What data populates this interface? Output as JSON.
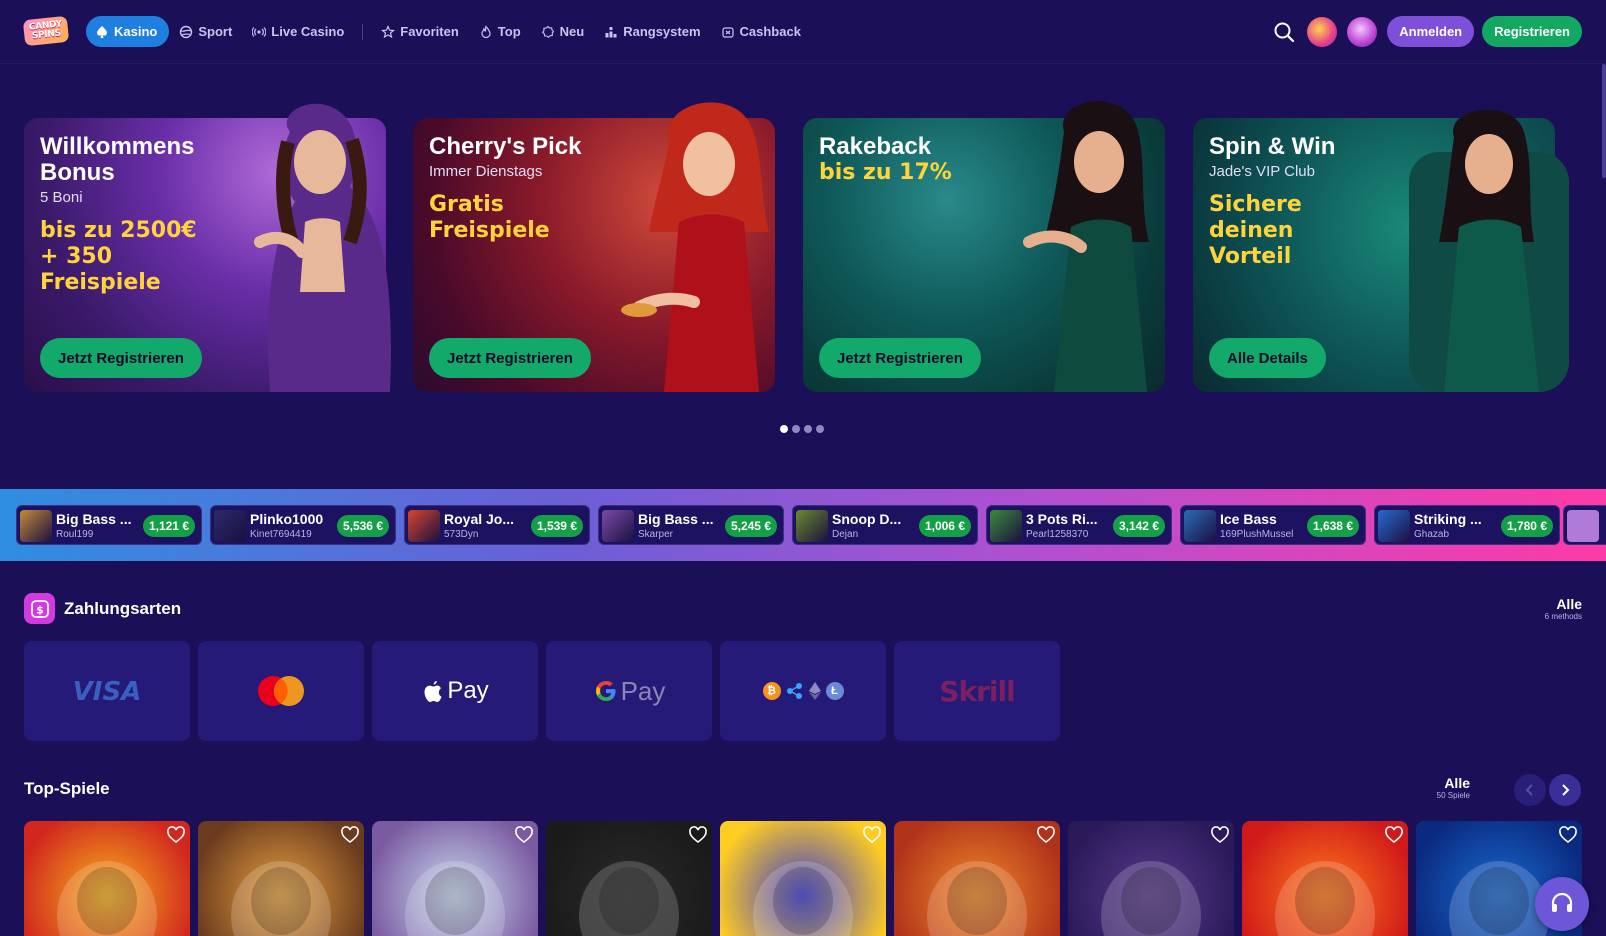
{
  "brand": {
    "logo_line1": "CANDY",
    "logo_line2": "SPINS"
  },
  "nav": {
    "items": [
      {
        "label": "Kasino",
        "icon": "spade-icon",
        "active": true
      },
      {
        "label": "Sport",
        "icon": "ball-icon"
      },
      {
        "label": "Live Casino",
        "icon": "broadcast-icon"
      },
      {
        "label": "Favoriten",
        "icon": "star-icon"
      },
      {
        "label": "Top",
        "icon": "flame-icon"
      },
      {
        "label": "Neu",
        "icon": "new-badge-icon"
      },
      {
        "label": "Rangsystem",
        "icon": "ranking-icon"
      },
      {
        "label": "Cashback",
        "icon": "cashback-icon"
      }
    ]
  },
  "header": {
    "login_label": "Anmelden",
    "register_label": "Registrieren"
  },
  "banners": [
    {
      "title": "Willkommens Bonus",
      "subtitle": "5 Boni",
      "highlight1": "bis zu 2500€",
      "highlight2": "+ 350",
      "highlight3": "Freispiele",
      "button": "Jetzt Registrieren",
      "theme": "purple"
    },
    {
      "title": "Cherry's Pick",
      "subtitle": "Immer Dienstags",
      "highlight1": "Gratis",
      "highlight2": "Freispiele",
      "button": "Jetzt Registrieren",
      "theme": "red"
    },
    {
      "title": "Rakeback",
      "subtitle": "",
      "highlight1": "bis zu 17%",
      "button": "Jetzt Registrieren",
      "theme": "teal"
    },
    {
      "title": "Spin & Win",
      "subtitle": "Jade's VIP Club",
      "highlight1": "Sichere",
      "highlight2": "deinen",
      "highlight3": "Vorteil",
      "button": "Alle Details",
      "theme": "green"
    }
  ],
  "carousel": {
    "pages": 4,
    "active": 0
  },
  "recent_wins": [
    {
      "game": "Big Bass ...",
      "user": "Roul199",
      "amount": "1,121 €",
      "color": "#c58a3a"
    },
    {
      "game": "Plinko1000",
      "user": "Kinet7694419",
      "amount": "5,536 €",
      "color": "#2b2a6a"
    },
    {
      "game": "Royal Jo...",
      "user": "573Dyn",
      "amount": "1,539 €",
      "color": "#d8452c"
    },
    {
      "game": "Big Bass ...",
      "user": "Skarper",
      "amount": "5,245 €",
      "color": "#7d4aa8"
    },
    {
      "game": "Snoop D...",
      "user": "Dejan",
      "amount": "1,006 €",
      "color": "#6b8a2a"
    },
    {
      "game": "3 Pots Ri...",
      "user": "Pearl1258370",
      "amount": "3,142 €",
      "color": "#3d8a3d"
    },
    {
      "game": "Ice Bass",
      "user": "169PlushMussel",
      "amount": "1,638 €",
      "color": "#2b6bb8"
    },
    {
      "game": "Striking ...",
      "user": "Ghazab",
      "amount": "1,780 €",
      "color": "#2a6ad0"
    }
  ],
  "payments": {
    "title": "Zahlungsarten",
    "all_label": "Alle",
    "count_label": "6 methods",
    "methods": [
      {
        "name": "VISA",
        "icon": "visa-logo"
      },
      {
        "name": "Mastercard",
        "icon": "mastercard-logo"
      },
      {
        "name": "Pay",
        "icon": "apple-pay-logo"
      },
      {
        "name": "Pay",
        "icon": "google-pay-logo"
      },
      {
        "name": "Crypto",
        "icon": "crypto-logos"
      },
      {
        "name": "Skrill",
        "icon": "skrill-logo"
      }
    ]
  },
  "top_games": {
    "title": "Top-Spiele",
    "all_label": "Alle",
    "count_label": "50 Spiele",
    "games": [
      {
        "theme": "jester",
        "colors": [
          "#f5b31c",
          "#d2271e"
        ]
      },
      {
        "theme": "cowboy-fisher",
        "colors": [
          "#e7a13f",
          "#6b3b1f"
        ]
      },
      {
        "theme": "pig",
        "colors": [
          "#c8d9f0",
          "#7a5aa0"
        ]
      },
      {
        "theme": "cactus",
        "colors": [
          "#2a2a2a",
          "#1a1a1a"
        ]
      },
      {
        "theme": "lightning",
        "colors": [
          "#3a3ad0",
          "#ffcc22"
        ]
      },
      {
        "theme": "explorer",
        "colors": [
          "#f08a2a",
          "#b0321a"
        ]
      },
      {
        "theme": "geisha",
        "colors": [
          "#5a3a8a",
          "#2a1a5a"
        ]
      },
      {
        "theme": "lucky-seven",
        "colors": [
          "#ff7a1a",
          "#d01a1a"
        ]
      },
      {
        "theme": "portal",
        "colors": [
          "#1a6ad0",
          "#0a2a80"
        ]
      }
    ]
  }
}
